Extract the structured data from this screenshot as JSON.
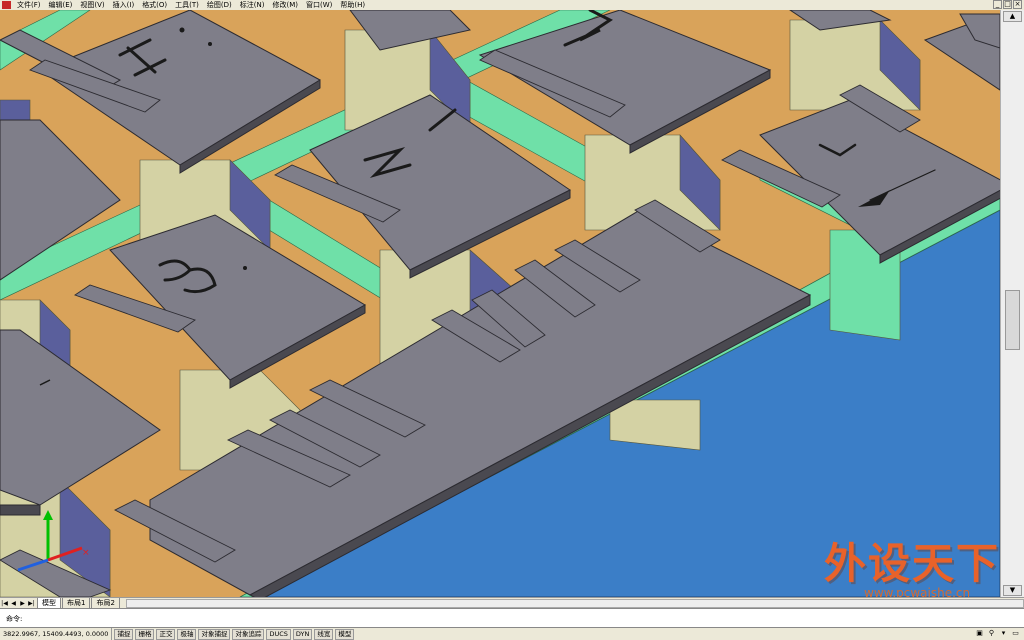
{
  "menu": {
    "items": [
      "文件(F)",
      "编辑(E)",
      "视图(V)",
      "插入(I)",
      "格式(O)",
      "工具(T)",
      "绘图(D)",
      "标注(N)",
      "修改(M)",
      "窗口(W)",
      "帮助(H)"
    ]
  },
  "window_controls": {
    "minimize": "_",
    "maximize": "□",
    "close": "×"
  },
  "keys": {
    "h": "H",
    "m": "M",
    "n_slash": "N/",
    "b": "B",
    "v": "V",
    "i": "I",
    "k": "K"
  },
  "layout_tabs": {
    "nav": [
      "|◀",
      "◀",
      "▶",
      "▶|"
    ],
    "tabs": [
      "模型",
      "布局1",
      "布局2"
    ],
    "active": "模型"
  },
  "command": {
    "prompt": "命令:",
    "value": ""
  },
  "status": {
    "coords": "3822.9967, 15409.4493, 0.0000",
    "toggles": [
      "捕捉",
      "栅格",
      "正交",
      "极轴",
      "对象捕捉",
      "对象追踪",
      "DUCS",
      "DYN",
      "线宽",
      "模型"
    ]
  },
  "watermark": {
    "main": "外设天下",
    "sub": "www.pcwaishe.cn"
  },
  "colors": {
    "keycap": "#7f7e89",
    "keycap_edge": "#4a4950",
    "stem": "#d4d2a4",
    "stem_shadow": "#5a5f9c",
    "plate": "#d9a35a",
    "rail": "#6fe0a8",
    "case": "#3b7ec7"
  }
}
